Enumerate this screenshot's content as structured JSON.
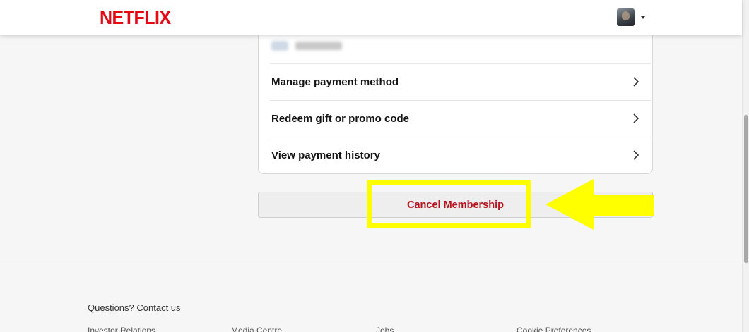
{
  "header": {
    "logo": "NETFLIX",
    "profile_icon": "avatar"
  },
  "payment": {
    "rows": [
      {
        "label": "Manage payment method",
        "icon": "chevron-right-icon"
      },
      {
        "label": "Redeem gift or promo code",
        "icon": "chevron-right-icon"
      },
      {
        "label": "View payment history",
        "icon": "chevron-right-icon"
      }
    ]
  },
  "cancel": {
    "label": "Cancel Membership"
  },
  "annotation": {
    "highlight_color": "#ffff00",
    "arrow_color": "#ffff00"
  },
  "footer": {
    "questions_text": "Questions?",
    "contact_link": "Contact us",
    "links": [
      "Investor Relations",
      "Media Centre",
      "Jobs",
      "Cookie Preferences"
    ]
  },
  "colors": {
    "brand": "#e50914",
    "cancel_text": "#b5121b"
  }
}
